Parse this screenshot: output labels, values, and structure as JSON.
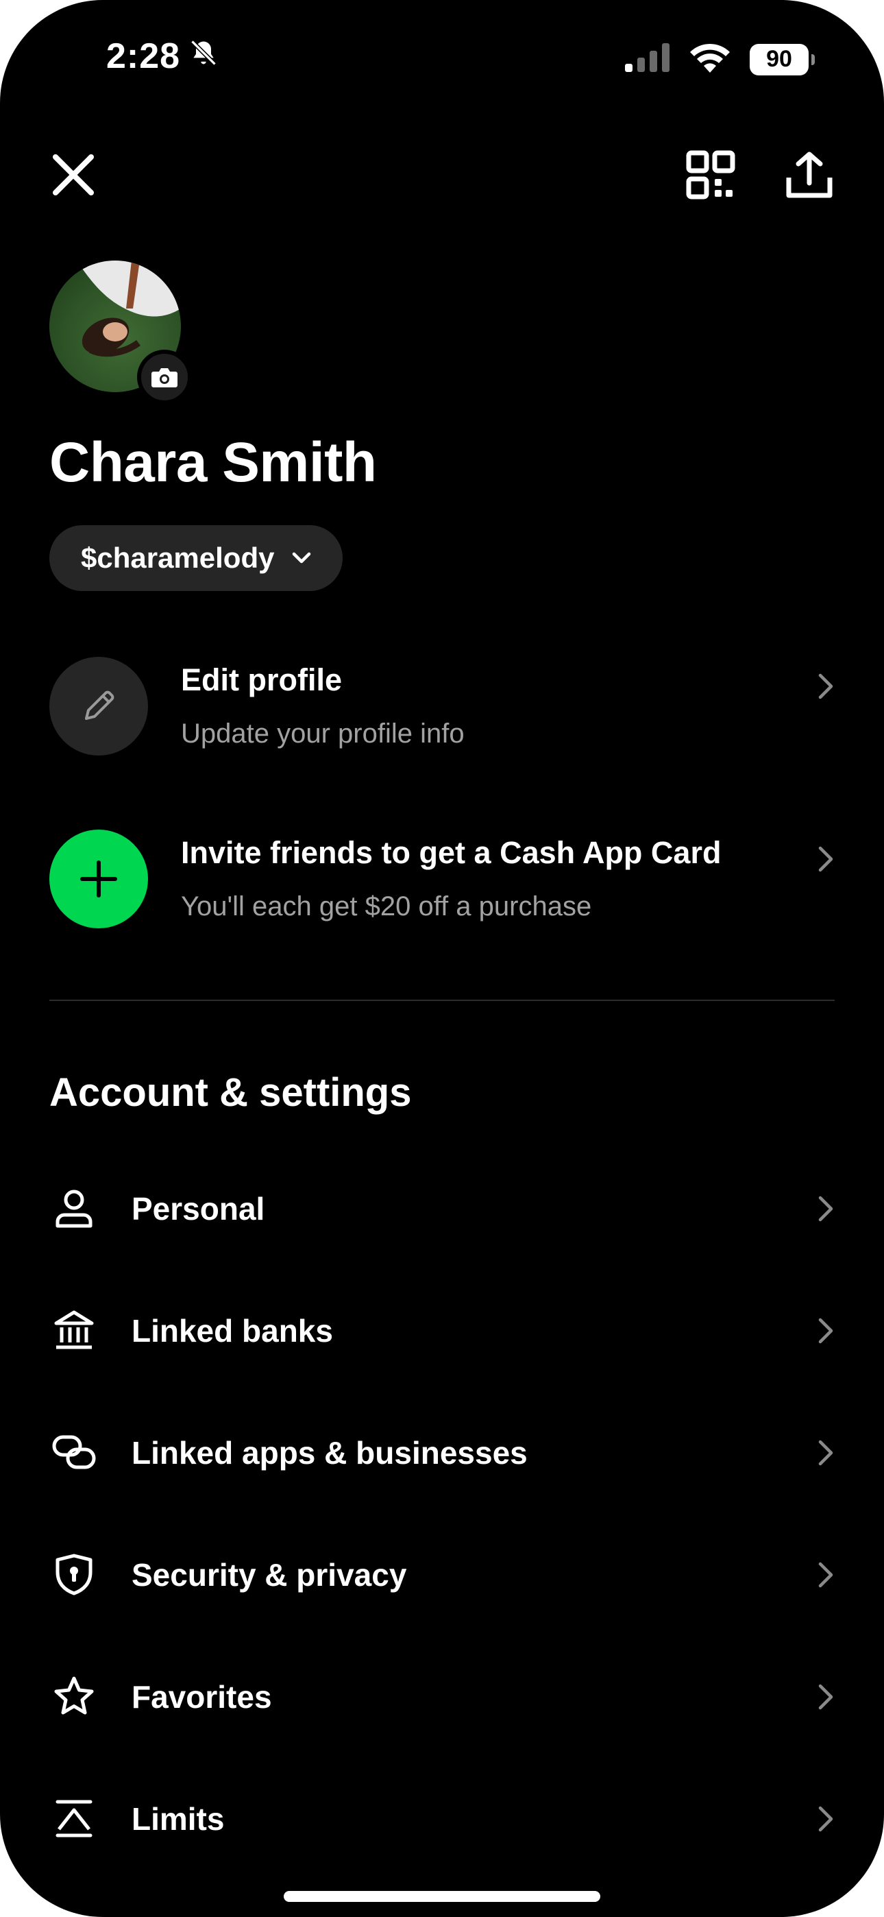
{
  "status_bar": {
    "time": "2:28",
    "battery": "90",
    "icons": [
      "bell-slash-icon",
      "signal-icon",
      "wifi-icon",
      "battery-icon"
    ]
  },
  "header": {
    "icons": [
      "close-icon",
      "qr-code-icon",
      "share-icon"
    ]
  },
  "profile": {
    "name": "Chara Smith",
    "cashtag": "$charamelody",
    "avatar_badge_icon": "camera-icon"
  },
  "actions": [
    {
      "title": "Edit profile",
      "subtitle": "Update your profile info",
      "icon": "pencil-icon",
      "icon_bg": "#262626"
    },
    {
      "title": "Invite friends to get a Cash App Card",
      "subtitle": "You'll each get $20 off a purchase",
      "icon": "plus-icon",
      "icon_bg": "#00D64F"
    }
  ],
  "settings": {
    "heading": "Account & settings",
    "items": [
      {
        "label": "Personal",
        "icon": "person-icon"
      },
      {
        "label": "Linked banks",
        "icon": "bank-icon"
      },
      {
        "label": "Linked apps & businesses",
        "icon": "link-icon"
      },
      {
        "label": "Security & privacy",
        "icon": "shield-icon"
      },
      {
        "label": "Favorites",
        "icon": "star-icon"
      },
      {
        "label": "Limits",
        "icon": "limits-icon"
      }
    ]
  },
  "colors": {
    "background": "#000000",
    "accent_green": "#00D64F",
    "pill_bg": "#262626",
    "secondary_text": "#A2A2A2"
  }
}
